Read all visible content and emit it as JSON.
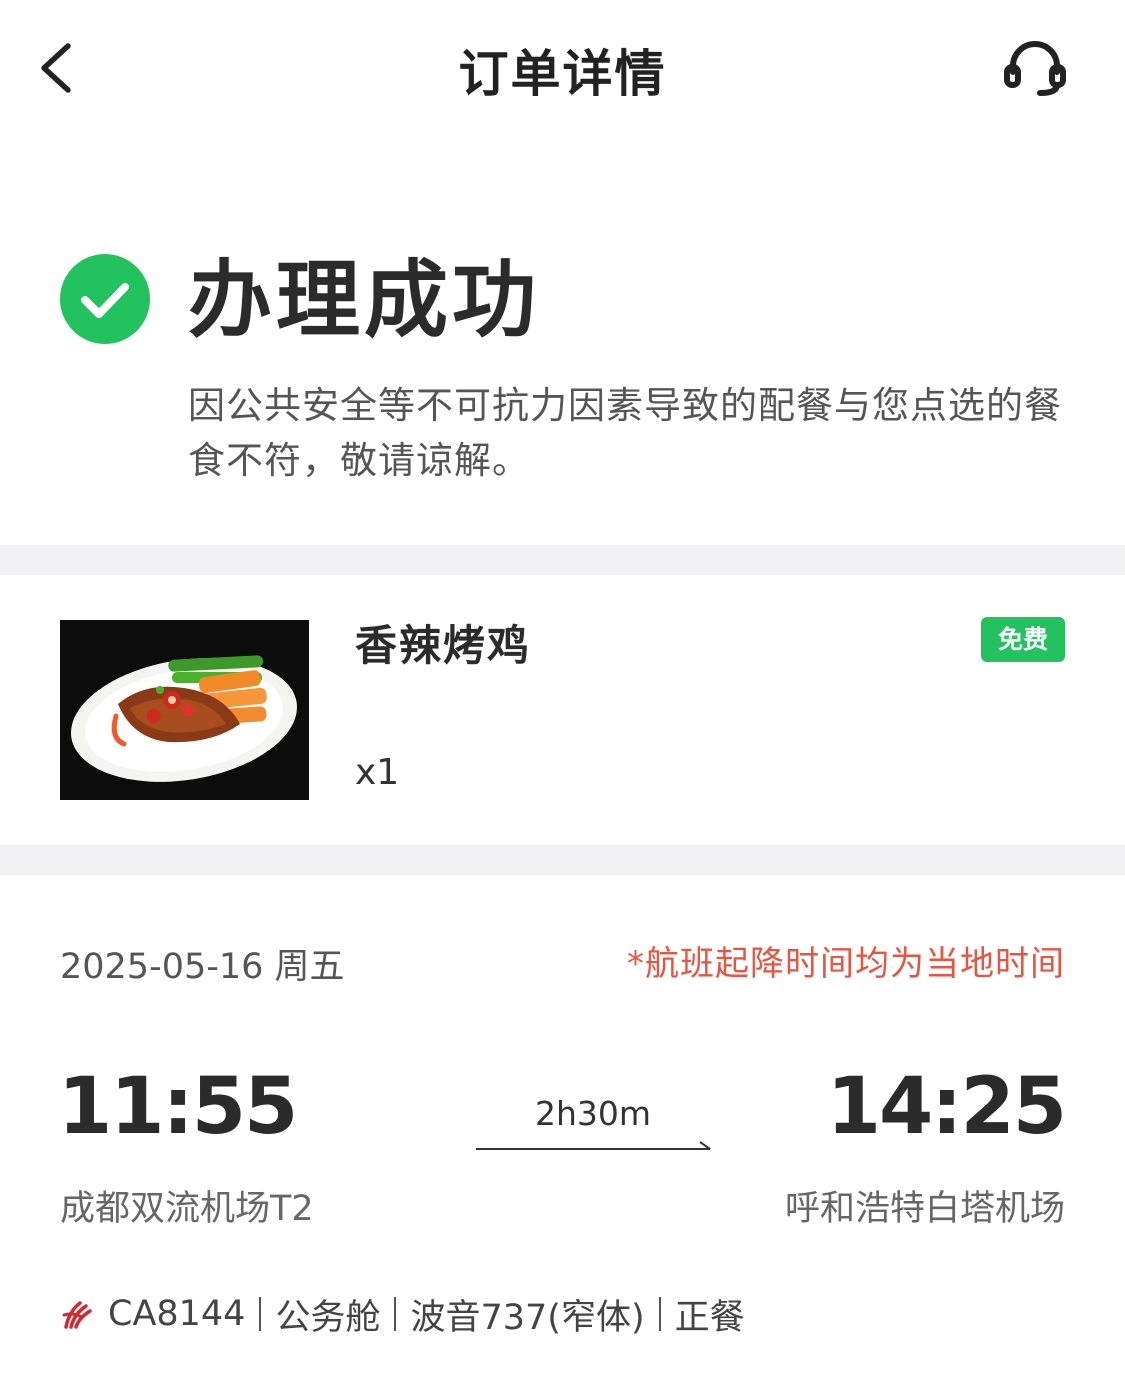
{
  "nav": {
    "title": "订单详情",
    "back_icon": "chevron-left-icon",
    "service_icon": "headset-icon"
  },
  "status": {
    "icon": "check-circle-icon",
    "title": "办理成功",
    "description": "因公共安全等不可抗力因素导致的配餐与您点选的餐食不符，敬请谅解。",
    "color": "#22c35e"
  },
  "meal": {
    "name": "香辣烤鸡",
    "badge": "免费",
    "quantity": "x1",
    "badge_color": "#22c35e"
  },
  "flight": {
    "date": "2025-05-16 周五",
    "note": "*航班起降时间均为当地时间",
    "note_color": "#e8543f",
    "departure": {
      "time": "11:55",
      "airport": "成都双流机场T2"
    },
    "arrival": {
      "time": "14:25",
      "airport": "呼和浩特白塔机场"
    },
    "duration": "2h30m",
    "flight_no": "CA8144",
    "cabin": "公务舱",
    "aircraft": "波音737(窄体)",
    "meal_type": "正餐",
    "airline_logo_color": "#d7262e"
  }
}
